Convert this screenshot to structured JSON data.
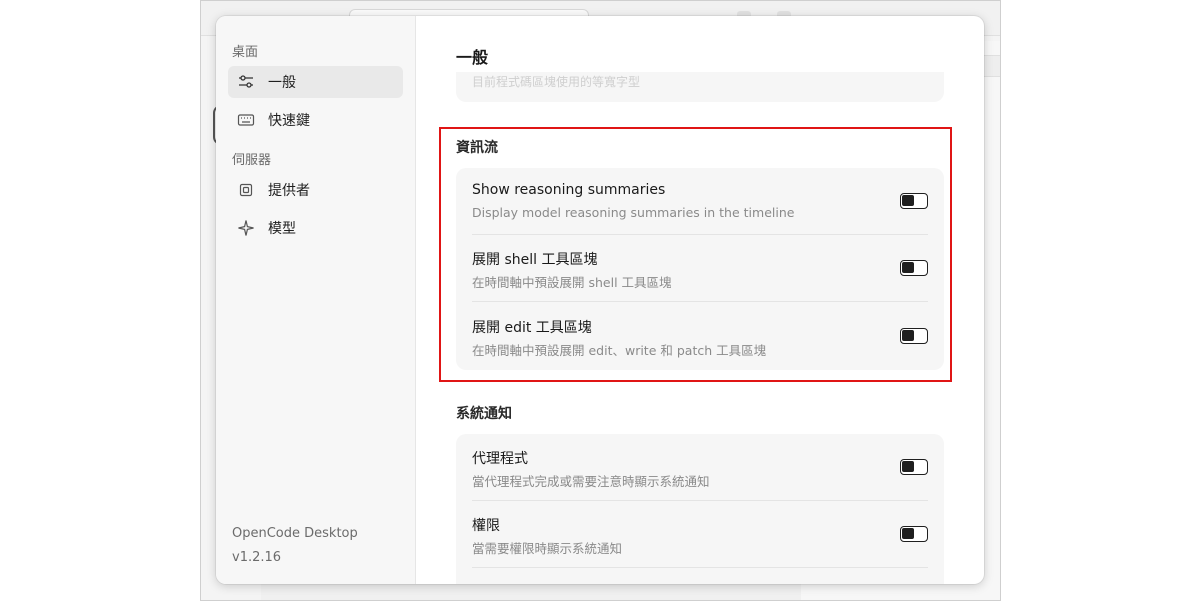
{
  "sidebar": {
    "sections": [
      {
        "label": "桌面",
        "items": [
          {
            "label": "一般",
            "icon": "sliders-icon",
            "active": true
          },
          {
            "label": "快速鍵",
            "icon": "keyboard-icon",
            "active": false
          }
        ]
      },
      {
        "label": "伺服器",
        "items": [
          {
            "label": "提供者",
            "icon": "chip-icon",
            "active": false
          },
          {
            "label": "模型",
            "icon": "sparkle-icon",
            "active": false
          }
        ]
      }
    ],
    "app_name": "OpenCode Desktop",
    "version": "v1.2.16"
  },
  "content": {
    "title": "一般",
    "faded_text": "目前程式碼區塊使用的等寬字型",
    "groups": [
      {
        "title": "資訊流",
        "rows": [
          {
            "title": "Show reasoning summaries",
            "description": "Display model reasoning summaries in the timeline",
            "enabled": true
          },
          {
            "title": "展開 shell 工具區塊",
            "description": "在時間軸中預設展開 shell 工具區塊",
            "enabled": true
          },
          {
            "title": "展開 edit 工具區塊",
            "description": "在時間軸中預設展開 edit、write 和 patch 工具區塊",
            "enabled": true
          }
        ]
      },
      {
        "title": "系統通知",
        "rows": [
          {
            "title": "代理程式",
            "description": "當代理程式完成或需要注意時顯示系統通知",
            "enabled": true
          },
          {
            "title": "權限",
            "description": "當需要權限時顯示系統通知",
            "enabled": true
          }
        ]
      }
    ]
  },
  "colors": {
    "highlight_border": "#e01515",
    "toggle_on": "#1f1f1f",
    "sidebar_bg": "#f7f7f7",
    "card_bg": "#f6f6f6"
  }
}
